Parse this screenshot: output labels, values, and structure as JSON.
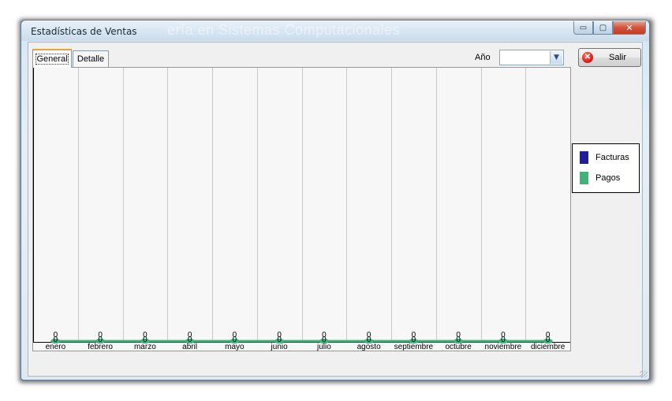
{
  "window": {
    "title": "Estadísticas de Ventas",
    "ghost_text": "ería en Sistemas Computacionales",
    "min_glyph": "▭",
    "max_glyph": "▢",
    "close_glyph": "✕"
  },
  "tabs": [
    {
      "label": "General",
      "active": true
    },
    {
      "label": "Detalle",
      "active": false
    }
  ],
  "controls": {
    "year_label": "Año",
    "year_value": "",
    "salir_label": "Salir",
    "salir_icon": "close-circle-icon"
  },
  "legend": [
    {
      "label": "Facturas",
      "color": "#1f1f9e"
    },
    {
      "label": "Pagos",
      "color": "#3eb578"
    }
  ],
  "chart_data": {
    "type": "area",
    "categories": [
      "enero",
      "febrero",
      "marzo",
      "abril",
      "mayo",
      "junio",
      "julio",
      "agosto",
      "septiembre",
      "octubre",
      "noviembre",
      "diciembre"
    ],
    "series": [
      {
        "name": "Facturas",
        "color": "#1f1f9e",
        "values": [
          0,
          0,
          0,
          0,
          0,
          0,
          0,
          0,
          0,
          0,
          0,
          0
        ]
      },
      {
        "name": "Pagos",
        "color": "#3eb578",
        "values": [
          0,
          0,
          0,
          0,
          0,
          0,
          0,
          0,
          0,
          0,
          0,
          0
        ]
      }
    ],
    "data_label_pairs": [
      [
        "0",
        "0"
      ],
      [
        "0",
        "0"
      ],
      [
        "0",
        "0"
      ],
      [
        "0",
        "0"
      ],
      [
        "0",
        "0"
      ],
      [
        "0",
        "0"
      ],
      [
        "0",
        "0"
      ],
      [
        "0",
        "0"
      ],
      [
        "0",
        "0"
      ],
      [
        "0",
        "0"
      ],
      [
        "0",
        "0"
      ],
      [
        "0",
        "0"
      ]
    ],
    "grid": "vertical",
    "legend_position": "right"
  }
}
